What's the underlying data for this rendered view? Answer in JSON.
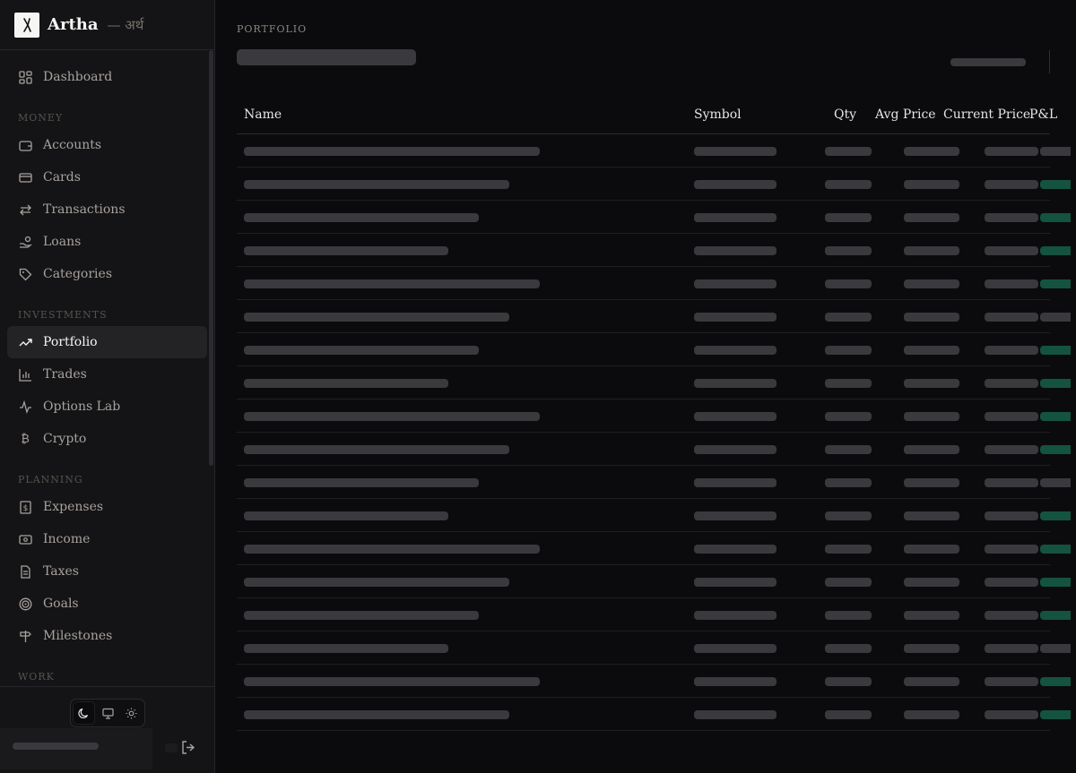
{
  "brand": {
    "name": "Artha",
    "subtitle": "— अर्थ"
  },
  "nav": {
    "dashboard": "Dashboard",
    "sections": [
      {
        "label": "MONEY",
        "items": [
          "Accounts",
          "Cards",
          "Transactions",
          "Loans",
          "Categories"
        ]
      },
      {
        "label": "INVESTMENTS",
        "items": [
          "Portfolio",
          "Trades",
          "Options Lab",
          "Crypto"
        ]
      },
      {
        "label": "PLANNING",
        "items": [
          "Expenses",
          "Income",
          "Taxes",
          "Goals",
          "Milestones"
        ]
      },
      {
        "label": "WORK",
        "items": []
      }
    ],
    "active": "Portfolio"
  },
  "page": {
    "eyebrow": "PORTFOLIO"
  },
  "table": {
    "columns": [
      "Name",
      "Symbol",
      "Qty",
      "Avg Price",
      "Current Price",
      "P&L"
    ],
    "loading": true,
    "row_count": 18,
    "pl_states": [
      "neutral",
      "positive",
      "positive",
      "positive",
      "positive",
      "neutral",
      "positive",
      "positive",
      "positive",
      "positive",
      "neutral",
      "positive",
      "positive",
      "positive",
      "positive",
      "neutral",
      "positive",
      "positive"
    ]
  },
  "theme": {
    "options": [
      "dark",
      "system",
      "light"
    ],
    "selected": "dark"
  },
  "colors": {
    "positive": "#14533f",
    "skeleton": "#3a3a3e",
    "background": "#0b0b0d",
    "sidebar": "#141416"
  }
}
